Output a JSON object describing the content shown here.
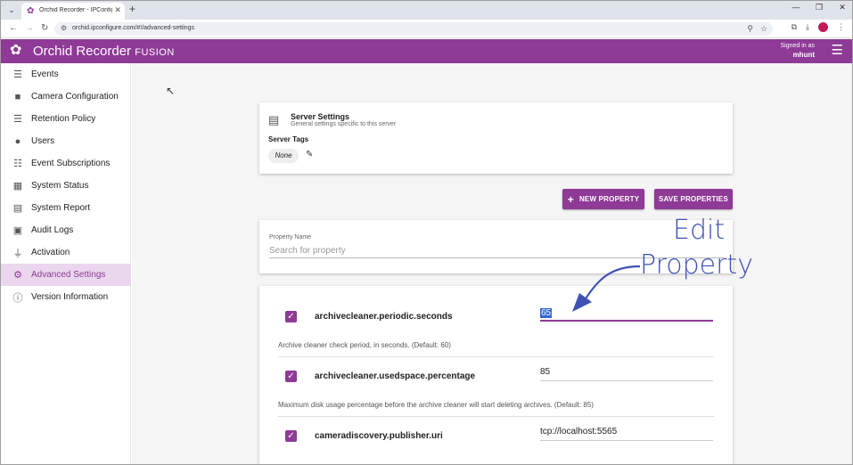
{
  "browser": {
    "tab_title": "Orchid Recorder - IPConfigure",
    "url": "orchid.ipconfigure.com/#!/advanced-settings"
  },
  "header": {
    "app_name": "Orchid Recorder",
    "app_suffix": "FUSION",
    "signed_in_label": "Signed in as",
    "username": "mhunt"
  },
  "sidebar": {
    "items": [
      {
        "label": "Events",
        "icon": "events-search-icon"
      },
      {
        "label": "Camera Configuration",
        "icon": "camera-icon"
      },
      {
        "label": "Retention Policy",
        "icon": "database-icon"
      },
      {
        "label": "Users",
        "icon": "user-icon"
      },
      {
        "label": "Event Subscriptions",
        "icon": "event-subscription-icon"
      },
      {
        "label": "System Status",
        "icon": "system-status-icon"
      },
      {
        "label": "System Report",
        "icon": "report-icon"
      },
      {
        "label": "Audit Logs",
        "icon": "audit-icon"
      },
      {
        "label": "Activation",
        "icon": "plug-icon"
      },
      {
        "label": "Advanced Settings",
        "icon": "gears-icon"
      },
      {
        "label": "Version Information",
        "icon": "info-icon"
      }
    ],
    "active": "Advanced Settings"
  },
  "server_settings": {
    "title": "Server Settings",
    "subtitle": "General settings specific to this server",
    "tags_label": "Server Tags",
    "tag_value": "None"
  },
  "actions": {
    "new_property": "NEW PROPERTY",
    "save_properties": "SAVE PROPERTIES"
  },
  "search": {
    "label": "Property Name",
    "placeholder": "Search for property"
  },
  "properties": [
    {
      "name": "archivecleaner.periodic.seconds",
      "value": "65",
      "description": "Archive cleaner check period, in seconds. (Default: 60)",
      "checked": true
    },
    {
      "name": "archivecleaner.usedspace.percentage",
      "value": "85",
      "description": "Maximum disk usage percentage before the archive cleaner will start deleting archives. (Default: 85)",
      "checked": true
    },
    {
      "name": "cameradiscovery.publisher.uri",
      "value": "tcp://localhost:5565",
      "description": "",
      "checked": true
    }
  ],
  "annotation": {
    "line1": "Edit",
    "line2": "Property",
    "color": "#3f51b5"
  },
  "colors": {
    "brand": "#8e3a96",
    "sidebar_active_bg": "#ead7ed"
  }
}
